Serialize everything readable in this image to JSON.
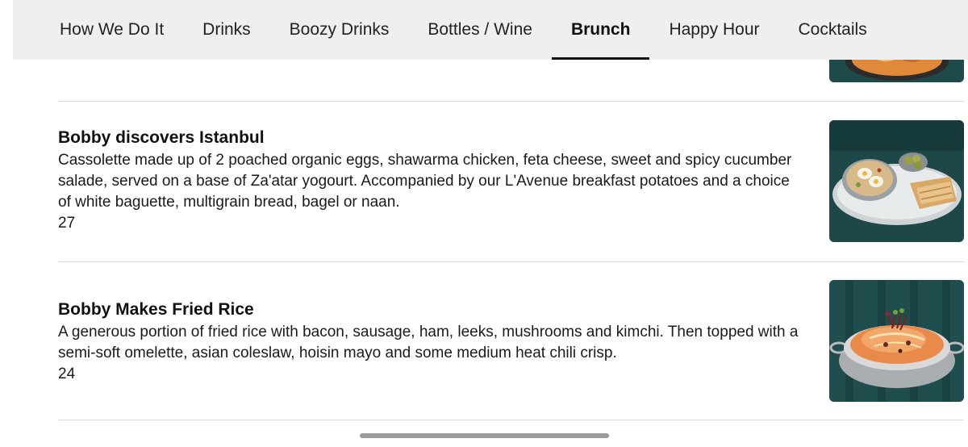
{
  "tabs": [
    {
      "label": "How We Do It",
      "active": false
    },
    {
      "label": "Drinks",
      "active": false
    },
    {
      "label": "Boozy Drinks",
      "active": false
    },
    {
      "label": "Bottles / Wine",
      "active": false
    },
    {
      "label": "Brunch",
      "active": true
    },
    {
      "label": "Happy Hour",
      "active": false
    },
    {
      "label": "Cocktails",
      "active": false
    }
  ],
  "menu_items": [
    {
      "name": "Bobby discovers Istanbul",
      "description": "Cassolette made up of 2 poached organic eggs, shawarma chicken, feta cheese, sweet and spicy cucumber salade, served on a base of Za'atar yogourt. Accompanied by our L'Avenue breakfast potatoes and a choice of white baguette, multigrain bread, bagel or naan.",
      "price": "27"
    },
    {
      "name": "Bobby Makes Fried Rice",
      "description": "A generous portion of fried rice with bacon, sausage, ham, leeks, mushrooms and kimchi. Then topped with a semi-soft omelette, asian coleslaw, hoisin mayo and some medium heat chili crisp.",
      "price": "24"
    }
  ],
  "colors": {
    "tabbar_bg": "#efefef",
    "text": "#111111",
    "divider": "#dddddd",
    "photo_bg": "#1f4a4a"
  }
}
